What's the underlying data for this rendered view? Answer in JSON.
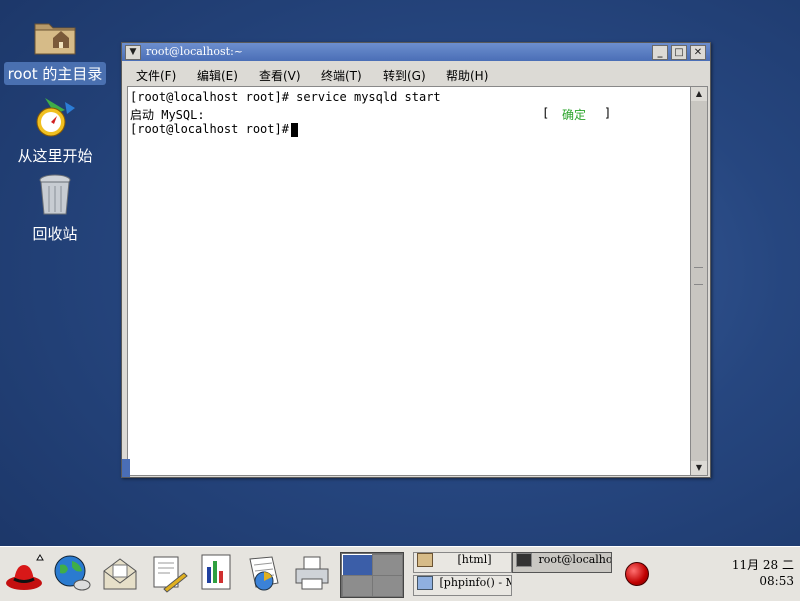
{
  "desktop": {
    "icons": [
      {
        "label": "root 的主目录",
        "icon": "home-folder-icon"
      },
      {
        "label": "从这里开始",
        "icon": "start-here-icon"
      },
      {
        "label": "回收站",
        "icon": "trash-icon"
      }
    ]
  },
  "window": {
    "title": "root@localhost:~",
    "menus": [
      "文件(F)",
      "编辑(E)",
      "查看(V)",
      "终端(T)",
      "转到(G)",
      "帮助(H)"
    ],
    "terminal_lines": [
      "[root@localhost root]# service mysqld start",
      "启动 MySQL:",
      "[root@localhost root]# "
    ],
    "status_open": "[",
    "status_ok": "确定",
    "status_close": "]"
  },
  "panel": {
    "launchers": [
      "redhat-menu-icon",
      "web-browser-icon",
      "email-icon",
      "writer-icon",
      "presentation-icon",
      "spreadsheet-icon",
      "printer-icon"
    ],
    "tasks": [
      "[html]",
      "root@localhost:~",
      "[phpinfo() - M"
    ],
    "clock_date": "11月 28 二",
    "clock_time": "08:53"
  },
  "colors": {
    "ok": "#2aa32a",
    "titlebar": "#4a6eb6",
    "desktop": "#26467f"
  }
}
